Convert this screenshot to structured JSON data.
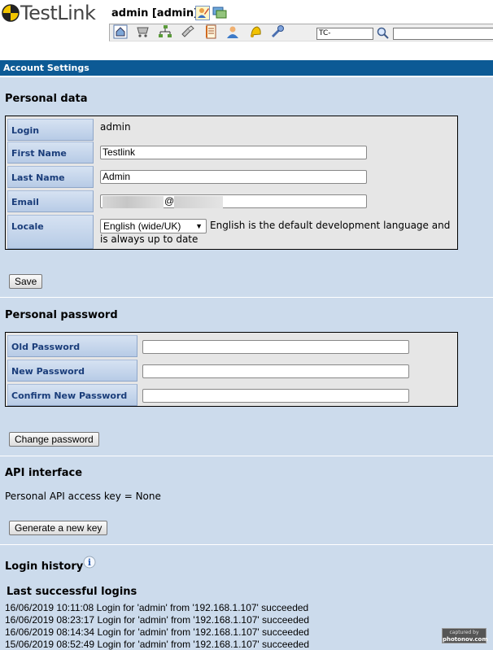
{
  "header": {
    "app_name": "TestLink",
    "user_title": "admin [admin]",
    "tc_prefix": "TC-",
    "search_value": "",
    "icons": [
      "edit-profile-icon",
      "projects-icon",
      "home-icon",
      "cart-icon",
      "tree-icon",
      "specs-icon",
      "notebook-icon",
      "user-icon",
      "bell-icon",
      "key-icon",
      "search-icon"
    ]
  },
  "page": {
    "title": "Account Settings"
  },
  "personal_data": {
    "heading": "Personal data",
    "login_label": "Login",
    "login_value": "admin",
    "first_name_label": "First Name",
    "first_name_value": "Testlink",
    "last_name_label": "Last Name",
    "last_name_value": "Admin",
    "email_label": "Email",
    "email_value": "@",
    "locale_label": "Locale",
    "locale_value": "English (wide/UK)",
    "locale_note": "English is the default development language and is always up to date",
    "save_button": "Save"
  },
  "password": {
    "heading": "Personal password",
    "old_label": "Old Password",
    "new_label": "New Password",
    "confirm_label": "Confirm New Password",
    "change_button": "Change password"
  },
  "api": {
    "heading": "API interface",
    "key_text": "Personal API access key = None",
    "generate_button": "Generate a new key"
  },
  "login_history": {
    "heading": "Login history",
    "subheading": "Last successful logins",
    "entries": [
      "16/06/2019 10:11:08 Login for 'admin' from '192.168.1.107' succeeded",
      "16/06/2019 08:23:17 Login for 'admin' from '192.168.1.107' succeeded",
      "16/06/2019 08:14:34 Login for 'admin' from '192.168.1.107' succeeded",
      "15/06/2019 08:52:49 Login for 'admin' from '192.168.1.107' succeeded"
    ]
  },
  "watermark": {
    "line1": "captured by",
    "line2": "photonov.com"
  },
  "colors": {
    "title_bar": "#0c5a95",
    "content_bg": "#ccdbec",
    "label_text": "#1a3d7a"
  }
}
